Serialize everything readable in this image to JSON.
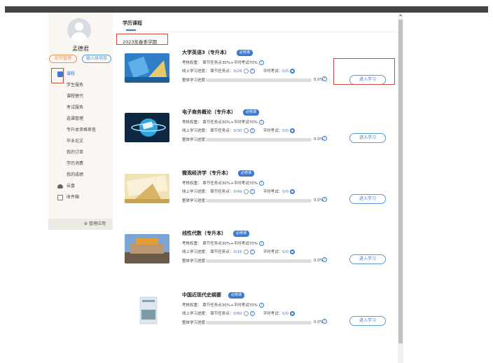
{
  "user": {
    "name": "孟德君",
    "badge_left": "前司管理",
    "badge_right": "输入原项目"
  },
  "sidebar": {
    "items": [
      {
        "label": "课程",
        "active": true,
        "icon": "book-icon"
      },
      {
        "label": "学生服务"
      },
      {
        "label": "课程替代"
      },
      {
        "label": "考试服务"
      },
      {
        "label": "选课管理"
      },
      {
        "label": "专升本资格审查"
      },
      {
        "label": "毕业论文"
      },
      {
        "label": "我的订单"
      },
      {
        "label": "学历消费"
      },
      {
        "label": "我的成绩"
      },
      {
        "label": "云盘",
        "icon": "cloud-icon"
      },
      {
        "label": "收件箱",
        "icon": "inbox-icon"
      }
    ],
    "manage": "⚙ 管理应用"
  },
  "main": {
    "tab": "学历课程",
    "semester": "2023年春季学期",
    "labels": {
      "tag": "必修课",
      "weight": "考核权重：  章节任务点30%+平时考试70%",
      "online": "线上学习进度：  章节任务点：",
      "quiz": "平时考试：",
      "overall": "整体学习进度：",
      "enter": "进入学习"
    },
    "courses": [
      {
        "title": "大学英语3（专升本）",
        "tasks": "0/26",
        "quiz": "0/0",
        "progress": "0.0%"
      },
      {
        "title": "电子商务概论（专升本）",
        "tasks": "0/30",
        "quiz": "0/0",
        "progress": "0.0%"
      },
      {
        "title": "微观经济学（专升本）",
        "tasks": "0/49",
        "quiz": "0/0",
        "progress": "0.0%"
      },
      {
        "title": "线性代数（专升本）",
        "tasks": "0/16",
        "quiz": "0/0",
        "progress": "0.0%"
      },
      {
        "title": "中国近现代史纲要",
        "tasks": "0/60",
        "quiz": "0/0",
        "progress": "0.0%"
      }
    ]
  }
}
